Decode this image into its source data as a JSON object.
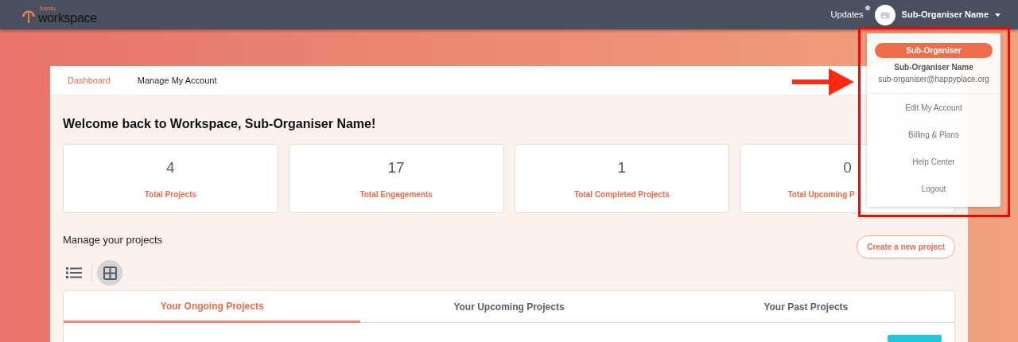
{
  "navbar": {
    "logo_small": "bantu",
    "logo_big": "workspace",
    "updates": {
      "label": "Updates",
      "unread": true
    },
    "user": "Sub-Organiser Name"
  },
  "account_menu": {
    "open": true,
    "role": "Sub-Organiser",
    "name": "Sub-Organiser Name",
    "email": "sub-organiser@happyplace.org",
    "items": [
      "Edit My Account",
      "Billing & Plans",
      "Help Center",
      "Logout"
    ]
  },
  "top_tabs": [
    {
      "label": "Dashboard",
      "selected": true
    },
    {
      "label": "Manage My Account",
      "selected": false
    }
  ],
  "welcome": "Welcome back to Workspace, Sub-Organiser Name!",
  "stats": [
    {
      "value": "4",
      "label": "Total Projects"
    },
    {
      "value": "17",
      "label": "Total Engagements"
    },
    {
      "value": "1",
      "label": "Total Completed Projects"
    },
    {
      "value": "0",
      "label": "Total Upcoming P"
    }
  ],
  "projects": {
    "heading": "Manage your projects",
    "create_button": "Create a new project",
    "views": [
      {
        "kind": "list",
        "selected": false
      },
      {
        "kind": "grid",
        "selected": true
      }
    ],
    "tabs": [
      {
        "label": "Your Ongoing Projects",
        "selected": true
      },
      {
        "label": "Your Upcoming Projects",
        "selected": false
      },
      {
        "label": "Your Past Projects",
        "selected": false
      }
    ]
  }
}
